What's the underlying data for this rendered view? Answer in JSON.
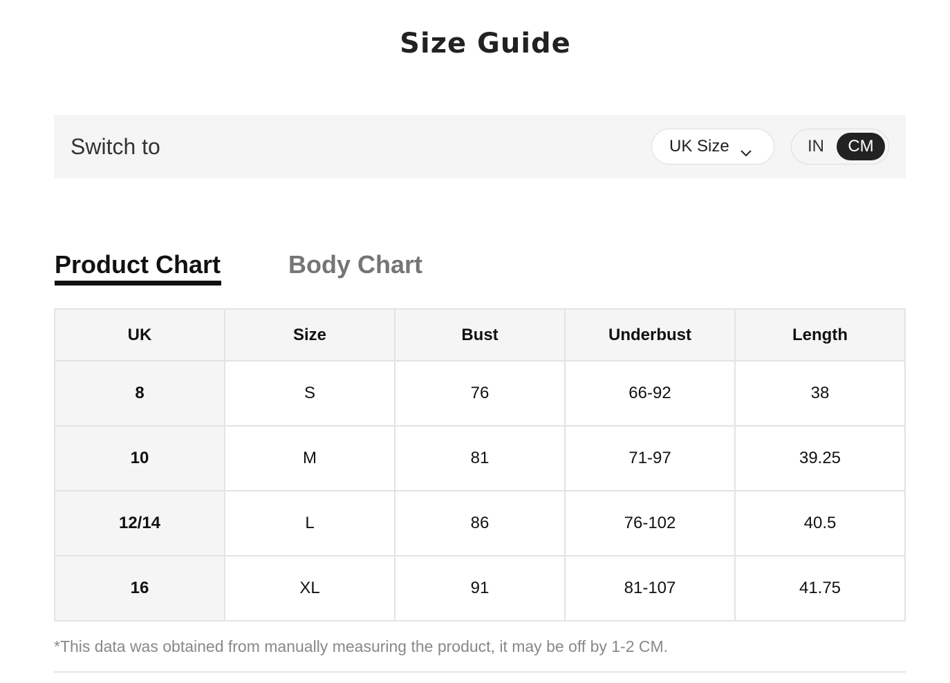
{
  "title": "Size Guide",
  "switch": {
    "label": "Switch to",
    "size_system": "UK Size",
    "units": {
      "option_in": "IN",
      "option_cm": "CM",
      "selected": "CM"
    }
  },
  "tabs": {
    "product": "Product Chart",
    "body": "Body Chart",
    "active": "Product Chart"
  },
  "table": {
    "headers": [
      "UK",
      "Size",
      "Bust",
      "Underbust",
      "Length"
    ],
    "rows": [
      [
        "8",
        "S",
        "76",
        "66-92",
        "38"
      ],
      [
        "10",
        "M",
        "81",
        "71-97",
        "39.25"
      ],
      [
        "12/14",
        "L",
        "86",
        "76-102",
        "40.5"
      ],
      [
        "16",
        "XL",
        "91",
        "81-107",
        "41.75"
      ]
    ]
  },
  "note": "*This data was obtained from manually measuring the product, it may be off by 1-2 CM.",
  "icons": {
    "size_select": "chevron-down-icon"
  },
  "colors": {
    "active_toggle_bg": "#222222",
    "header_bg": "#f5f5f5",
    "inactive_tab": "#757575"
  }
}
